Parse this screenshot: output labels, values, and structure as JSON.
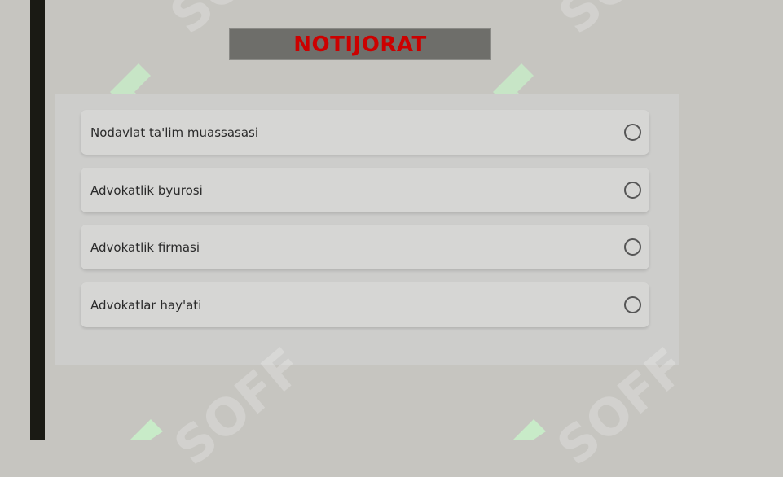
{
  "title": "NOTIJORAT",
  "watermark_text": "SOFF",
  "options": [
    {
      "label": "Nodavlat ta'lim muassasasi",
      "selected": false
    },
    {
      "label": "Advokatlik byurosi",
      "selected": false
    },
    {
      "label": "Advokatlik firmasi",
      "selected": false
    },
    {
      "label": "Advokatlar hay'ati",
      "selected": false
    }
  ],
  "colors": {
    "title_text": "#cc0000",
    "watermark_logo": "#c8ebc8"
  }
}
